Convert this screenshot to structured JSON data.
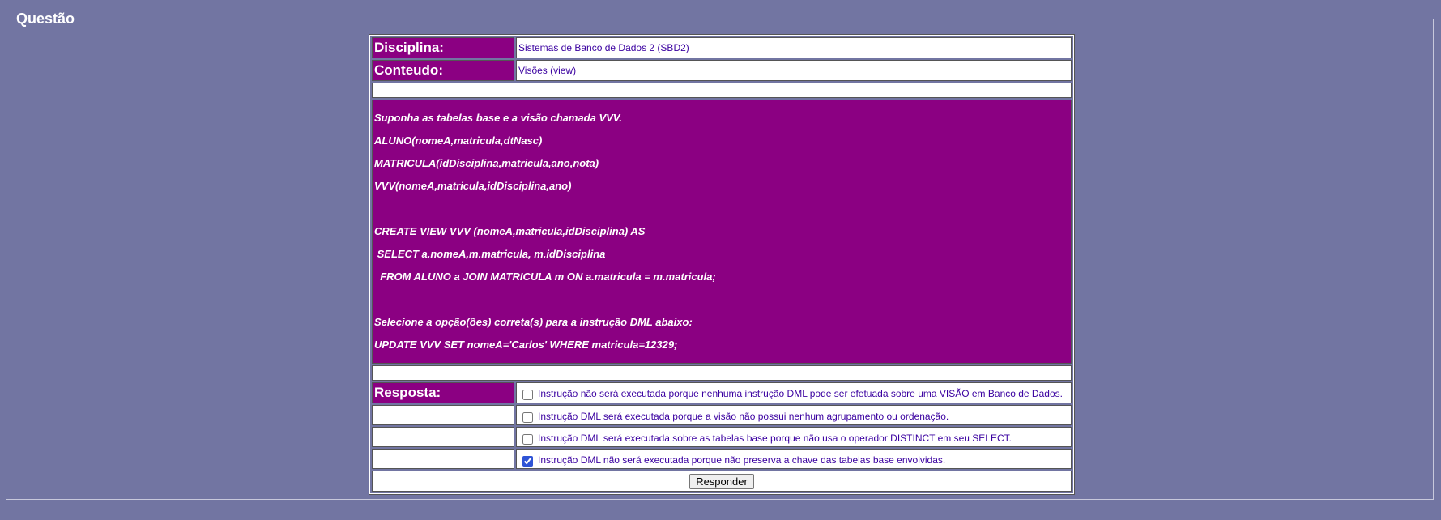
{
  "fieldset": {
    "legend": "Questão"
  },
  "disciplina": {
    "label": "Disciplina:",
    "value": "Sistemas de Banco de Dados 2 (SBD2)"
  },
  "conteudo": {
    "label": "Conteudo:",
    "value": "Visões (view)"
  },
  "enunciado": {
    "lines": [
      "Suponha as tabelas base e a visão chamada VVV.",
      "ALUNO(nomeA,matricula,dtNasc)",
      "MATRICULA(idDisciplina,matricula,ano,nota)",
      "VVV(nomeA,matricula,idDisciplina,ano)",
      "",
      "CREATE VIEW VVV (nomeA,matricula,idDisciplina) AS",
      " SELECT a.nomeA,m.matricula, m.idDisciplina",
      "  FROM ALUNO a JOIN MATRICULA m ON a.matricula = m.matricula;",
      "",
      "Selecione a opção(ões) correta(s) para a instrução DML abaixo:",
      "UPDATE VVV SET nomeA='Carlos' WHERE matricula=12329;"
    ]
  },
  "resposta": {
    "label": "Resposta:",
    "options": [
      {
        "text": "Instrução não será executada porque nenhuma instrução DML pode ser efetuada sobre uma VISÃO em Banco de Dados.",
        "checked": false
      },
      {
        "text": "Instrução DML será executada porque a visão não possui nenhum agrupamento ou ordenação.",
        "checked": false
      },
      {
        "text": "Instrução DML será executada sobre as tabelas base porque não usa o operador DISTINCT em seu SELECT.",
        "checked": false
      },
      {
        "text": "Instrução DML não será executada porque não preserva a chave das tabelas base envolvidas.",
        "checked": true
      }
    ]
  },
  "submit": {
    "label": "Responder"
  },
  "colors": {
    "background": "#7275a2",
    "label_bg": "#8b0082",
    "value_text": "#3a00a0"
  }
}
